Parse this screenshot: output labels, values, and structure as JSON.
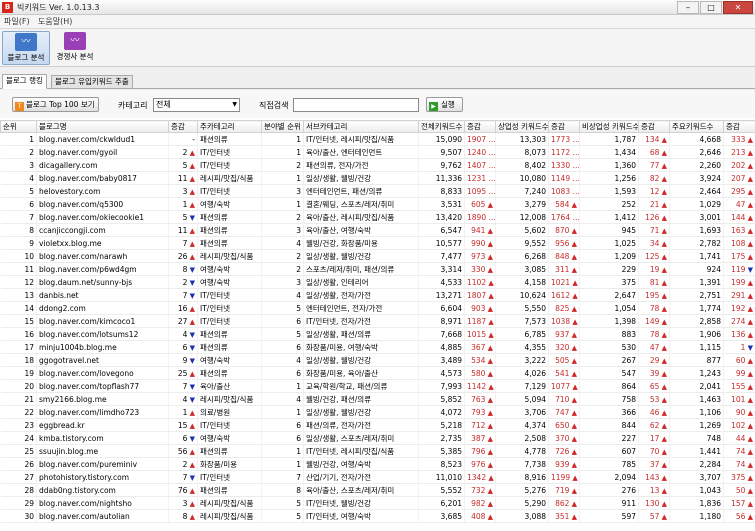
{
  "window": {
    "title": "빅키워드 Ver. 1.0.13.3",
    "minimize": "–",
    "maximize": "□",
    "close": "✕"
  },
  "menu": [
    "파일(F)",
    "도움말(H)"
  ],
  "toolbar": {
    "blog_analysis": "블로그 분석",
    "competitor_analysis": "경쟁사 분석"
  },
  "tabs": [
    "블로그 랭킹",
    "블로그 유입키워드 추출"
  ],
  "filters": {
    "top100_button": "블로그 Top 100 보기",
    "category_label": "카테고리",
    "category_value": "전체",
    "direct_search_label": "직접검색",
    "search_value": "",
    "run_button": "실행"
  },
  "colors": {
    "up": "#c62b2b",
    "down": "#2235b0",
    "accent": "#d9241c"
  },
  "table": {
    "headers": [
      "순위",
      "블로그명",
      "증감",
      "주카테고리",
      "분야별 순위",
      "서브카테고리",
      "전체키워드수",
      "증감",
      "상업성 키워드수",
      "증감",
      "비상업성 키워드수",
      "증감",
      "주요키워드수",
      "증감"
    ],
    "rows": [
      [
        "1",
        "blog.naver.com/ckwldud1",
        "-",
        "",
        "패션의류",
        "1",
        "IT/인터넷, 레시피/맛집/식품",
        "15,090",
        "1907",
        "",
        "13,303",
        "1773",
        "",
        "1,787",
        "134",
        "up",
        "4,668",
        "333",
        "up"
      ],
      [
        "2",
        "blog.naver.com/gyoil",
        "2",
        "up",
        "IT/인터넷",
        "1",
        "육아/출산, 엔터테인먼트",
        "9,507",
        "1240",
        "",
        "8,073",
        "1172",
        "",
        "1,434",
        "68",
        "up",
        "2,646",
        "213",
        "up"
      ],
      [
        "3",
        "dicagallery.com",
        "5",
        "up",
        "IT/인터넷",
        "2",
        "패션의류, 전자/가전",
        "9,762",
        "1407",
        "",
        "8,402",
        "1330",
        "",
        "1,360",
        "77",
        "up",
        "2,260",
        "202",
        "up"
      ],
      [
        "4",
        "blog.naver.com/baby0817",
        "11",
        "up",
        "레시피/맛집/식품",
        "1",
        "일상/생활, 웰빙/건강",
        "11,336",
        "1231",
        "",
        "10,080",
        "1149",
        "",
        "1,256",
        "82",
        "up",
        "3,924",
        "207",
        "up"
      ],
      [
        "5",
        "helovestory.com",
        "3",
        "up",
        "IT/인터넷",
        "3",
        "엔터테인먼트, 패션/의류",
        "8,833",
        "1095",
        "",
        "7,240",
        "1083",
        "",
        "1,593",
        "12",
        "up",
        "2,464",
        "295",
        "up"
      ],
      [
        "6",
        "blog.naver.com/q5300",
        "1",
        "up",
        "여행/숙박",
        "1",
        "결혼/웨딩, 스포츠/레저/취미",
        "3,531",
        "605",
        "up",
        "3,279",
        "584",
        "up",
        "252",
        "21",
        "up",
        "1,029",
        "47",
        "up"
      ],
      [
        "7",
        "blog.naver.com/okiecookie1",
        "5",
        "dn",
        "패션의류",
        "2",
        "육아/출산, 레시피/맛집/식품",
        "13,420",
        "1890",
        "",
        "12,008",
        "1764",
        "",
        "1,412",
        "126",
        "up",
        "3,001",
        "144",
        "up"
      ],
      [
        "8",
        "ccanjiccongji.com",
        "11",
        "up",
        "패션의류",
        "3",
        "육아/출산, 여행/숙박",
        "6,547",
        "941",
        "up",
        "5,602",
        "870",
        "up",
        "945",
        "71",
        "up",
        "1,693",
        "163",
        "up"
      ],
      [
        "9",
        "violetxx.blog.me",
        "7",
        "up",
        "패션의류",
        "4",
        "웰빙/건강, 화장품/미용",
        "10,577",
        "990",
        "up",
        "9,552",
        "956",
        "up",
        "1,025",
        "34",
        "up",
        "2,782",
        "108",
        "up"
      ],
      [
        "10",
        "blog.naver.com/narawh",
        "26",
        "up",
        "레시피/맛집/식품",
        "2",
        "일상/생활, 웰빙/건강",
        "7,477",
        "973",
        "up",
        "6,268",
        "848",
        "up",
        "1,209",
        "125",
        "up",
        "1,741",
        "175",
        "up"
      ],
      [
        "11",
        "blog.naver.com/p6wd4gm",
        "8",
        "dn",
        "여행/숙박",
        "2",
        "스포츠/레저/취미, 패션/의류",
        "3,314",
        "330",
        "up",
        "3,085",
        "311",
        "up",
        "229",
        "19",
        "up",
        "924",
        "119",
        "dn"
      ],
      [
        "12",
        "blog.daum.net/sunny-bjs",
        "2",
        "dn",
        "여행/숙박",
        "3",
        "일상/생활, 인테리어",
        "4,533",
        "1102",
        "up",
        "4,158",
        "1021",
        "up",
        "375",
        "81",
        "up",
        "1,391",
        "199",
        "up"
      ],
      [
        "13",
        "danbis.net",
        "7",
        "dn",
        "IT/인터넷",
        "4",
        "일상/생활, 전자/가전",
        "13,271",
        "1807",
        "up",
        "10,624",
        "1612",
        "up",
        "2,647",
        "195",
        "up",
        "2,751",
        "291",
        "up"
      ],
      [
        "14",
        "ddong2.com",
        "16",
        "up",
        "IT/인터넷",
        "5",
        "엔터테인먼트, 전자/가전",
        "6,604",
        "903",
        "up",
        "5,550",
        "825",
        "up",
        "1,054",
        "78",
        "up",
        "1,774",
        "192",
        "up"
      ],
      [
        "15",
        "blog.naver.com/kimcoco1",
        "27",
        "up",
        "IT/인터넷",
        "6",
        "IT/인터넷, 전자/가전",
        "8,971",
        "1187",
        "up",
        "7,573",
        "1038",
        "up",
        "1,398",
        "149",
        "up",
        "2,858",
        "274",
        "up"
      ],
      [
        "16",
        "blog.naver.com/lotsums12",
        "4",
        "dn",
        "패션의류",
        "5",
        "일상/생활, 패션/의류",
        "7,668",
        "1015",
        "up",
        "6,785",
        "937",
        "up",
        "883",
        "78",
        "up",
        "1,906",
        "136",
        "up"
      ],
      [
        "17",
        "minju1004b.blog.me",
        "6",
        "dn",
        "패션의류",
        "6",
        "화장품/미용, 여행/숙박",
        "4,885",
        "367",
        "up",
        "4,355",
        "320",
        "up",
        "530",
        "47",
        "up",
        "1,115",
        "1",
        "dn"
      ],
      [
        "18",
        "ggogotravel.net",
        "9",
        "dn",
        "여행/숙박",
        "4",
        "일상/생활, 웰빙/건강",
        "3,489",
        "534",
        "up",
        "3,222",
        "505",
        "up",
        "267",
        "29",
        "up",
        "877",
        "60",
        "up"
      ],
      [
        "19",
        "blog.naver.com/lovegono",
        "25",
        "up",
        "패션의류",
        "6",
        "화장품/미용, 육아/출산",
        "4,573",
        "580",
        "up",
        "4,026",
        "541",
        "up",
        "547",
        "39",
        "up",
        "1,243",
        "99",
        "up"
      ],
      [
        "20",
        "blog.naver.com/topflash77",
        "7",
        "dn",
        "육아/출산",
        "1",
        "교육/학원/학교, 패션/의류",
        "7,993",
        "1142",
        "up",
        "7,129",
        "1077",
        "up",
        "864",
        "65",
        "up",
        "2,041",
        "155",
        "up"
      ],
      [
        "21",
        "smy2166.blog.me",
        "4",
        "dn",
        "레시피/맛집/식품",
        "4",
        "웰빙/건강, 패션/의류",
        "5,852",
        "763",
        "up",
        "5,094",
        "710",
        "up",
        "758",
        "53",
        "up",
        "1,463",
        "101",
        "up"
      ],
      [
        "22",
        "blog.naver.com/limdho723",
        "1",
        "up",
        "의료/병원",
        "1",
        "일상/생활, 웰빙/건강",
        "4,072",
        "793",
        "up",
        "3,706",
        "747",
        "up",
        "366",
        "46",
        "up",
        "1,106",
        "90",
        "up"
      ],
      [
        "23",
        "eggbread.kr",
        "15",
        "up",
        "IT/인터넷",
        "6",
        "패션/의류, 전자/가전",
        "5,218",
        "712",
        "up",
        "4,374",
        "650",
        "up",
        "844",
        "62",
        "up",
        "1,269",
        "102",
        "up"
      ],
      [
        "24",
        "kmba.tistory.com",
        "6",
        "dn",
        "여행/숙박",
        "6",
        "일상/생활, 스포츠/레저/취미",
        "2,735",
        "387",
        "up",
        "2,508",
        "370",
        "up",
        "227",
        "17",
        "up",
        "748",
        "44",
        "up"
      ],
      [
        "25",
        "ssuujin.blog.me",
        "56",
        "up",
        "패션의류",
        "1",
        "IT/인터넷, 레시피/맛집/식품",
        "5,385",
        "796",
        "up",
        "4,778",
        "726",
        "up",
        "607",
        "70",
        "up",
        "1,441",
        "74",
        "up"
      ],
      [
        "26",
        "blog.naver.com/pureminiv",
        "2",
        "up",
        "화장품/미용",
        "1",
        "웰빙/건강, 여행/숙박",
        "8,523",
        "976",
        "up",
        "7,738",
        "939",
        "up",
        "785",
        "37",
        "up",
        "2,284",
        "74",
        "up"
      ],
      [
        "27",
        "photohistory.tistory.com",
        "7",
        "dn",
        "IT/인터넷",
        "7",
        "산업/기기, 전자/가전",
        "11,010",
        "1342",
        "up",
        "8,916",
        "1199",
        "up",
        "2,094",
        "143",
        "up",
        "3,707",
        "375",
        "up"
      ],
      [
        "28",
        "ddab0ng.tistory.com",
        "76",
        "up",
        "패션의류",
        "8",
        "육아/출산, 스포츠/레저/취미",
        "5,552",
        "732",
        "up",
        "5,276",
        "719",
        "up",
        "276",
        "13",
        "up",
        "1,043",
        "50",
        "up"
      ],
      [
        "29",
        "blog.naver.com/nightsho",
        "3",
        "up",
        "레시피/맛집/식품",
        "5",
        "IT/인터넷, 웰빙/건강",
        "6,201",
        "982",
        "up",
        "5,290",
        "862",
        "up",
        "911",
        "130",
        "up",
        "1,836",
        "157",
        "up"
      ],
      [
        "30",
        "blog.naver.com/autolian",
        "8",
        "up",
        "레시피/맛집/식품",
        "5",
        "IT/인터넷, 여행/숙박",
        "3,685",
        "408",
        "up",
        "3,088",
        "351",
        "up",
        "597",
        "57",
        "up",
        "1,180",
        "56",
        "up"
      ]
    ]
  }
}
